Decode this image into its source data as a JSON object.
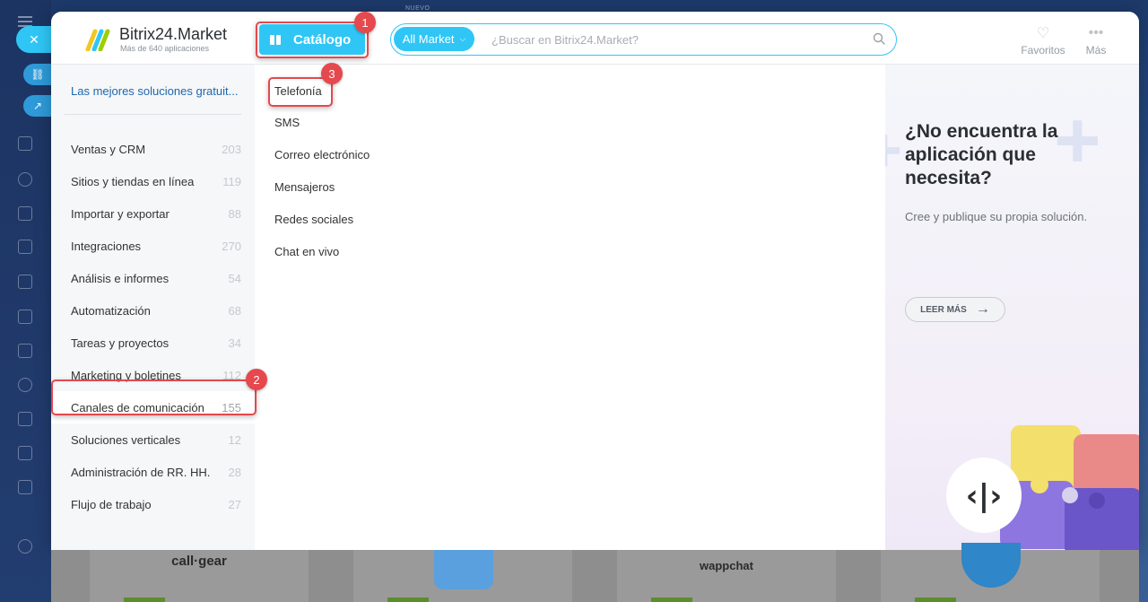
{
  "page": {
    "top_strip_label": "NUEVO"
  },
  "header": {
    "logo_title": "Bitrix24.Market",
    "logo_subtitle": "Más de 640 aplicaciones",
    "catalog_button": "Catálogo",
    "search": {
      "scope": "All Market",
      "placeholder": "¿Buscar en Bitrix24.Market?",
      "value": ""
    },
    "favorites_label": "Favoritos",
    "more_label": "Más"
  },
  "annotations": {
    "step1": "1",
    "step2": "2",
    "step3": "3"
  },
  "sidebar": {
    "best_link": "Las mejores soluciones gratuit...",
    "categories": [
      {
        "label": "Ventas y CRM",
        "count": "203"
      },
      {
        "label": "Sitios y tiendas en línea",
        "count": "119"
      },
      {
        "label": "Importar y exportar",
        "count": "88"
      },
      {
        "label": "Integraciones",
        "count": "270"
      },
      {
        "label": "Análisis e informes",
        "count": "54"
      },
      {
        "label": "Automatización",
        "count": "68"
      },
      {
        "label": "Tareas y proyectos",
        "count": "34"
      },
      {
        "label": "Marketing y boletines",
        "count": "112"
      },
      {
        "label": "Canales de comunicación",
        "count": "155"
      },
      {
        "label": "Soluciones verticales",
        "count": "12"
      },
      {
        "label": "Administración de RR. HH.",
        "count": "28"
      },
      {
        "label": "Flujo de trabajo",
        "count": "27"
      }
    ],
    "active_index": 8
  },
  "subcategories": [
    "Telefonía",
    "SMS",
    "Correo electrónico",
    "Mensajeros",
    "Redes sociales",
    "Chat en vivo"
  ],
  "promo": {
    "title": "¿No encuentra la aplicación que necesita?",
    "text": "Cree y publique su propia solución.",
    "button": "LEER MÁS"
  },
  "background_cards": [
    {
      "logo": "call·gear"
    },
    {
      "logo": ""
    },
    {
      "logo": "wappchat"
    },
    {
      "logo": ""
    }
  ],
  "colors": {
    "accent": "#2fc6f6",
    "annotation": "#e5484d",
    "link": "#2067b0"
  }
}
